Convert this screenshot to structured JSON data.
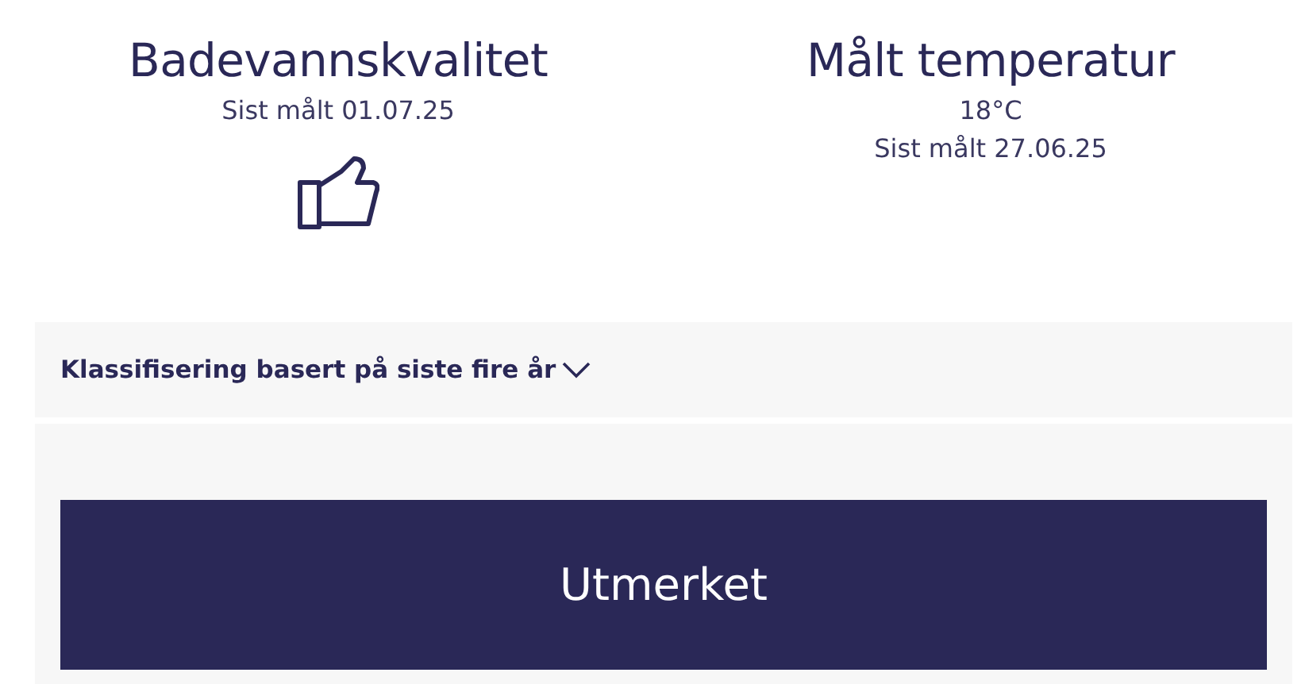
{
  "stats": [
    {
      "kind": "quality",
      "title": "Badevannskvalitet",
      "lines": [
        "Sist målt 01.07.25"
      ]
    },
    {
      "kind": "temperature",
      "title": "Målt temperatur",
      "lines": [
        "18°C",
        "Sist målt 27.06.25"
      ]
    }
  ],
  "classification": {
    "label": "Klassifisering basert på siste fire år",
    "expanded": false,
    "result": "Utmerket"
  }
}
